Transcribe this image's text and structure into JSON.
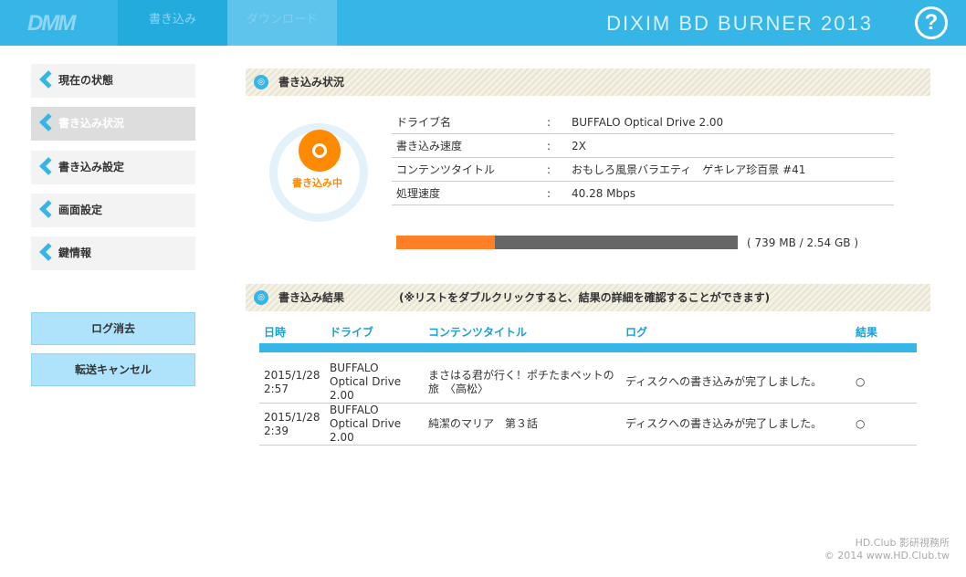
{
  "header": {
    "logo": "DMM",
    "tabs": [
      "書き込み",
      "ダウンロード"
    ],
    "title": "DIXIM BD BURNER 2013",
    "help": "?"
  },
  "sidebar": {
    "items": [
      "現在の状態",
      "書き込み状況",
      "書き込み設定",
      "画面設定",
      "鍵情報"
    ],
    "buttons": [
      "ログ消去",
      "転送キャンセル"
    ]
  },
  "status": {
    "heading": "書き込み状況",
    "state_label": "書き込み中",
    "rows": [
      {
        "k": "ドライブ名",
        "v": "BUFFALO Optical Drive 2.00"
      },
      {
        "k": "書き込み速度",
        "v": "2X"
      },
      {
        "k": "コンテンツタイトル",
        "v": "おもしろ風景バラエティ　ゲキレア珍百景 #41"
      },
      {
        "k": "処理速度",
        "v": "40.28 Mbps"
      }
    ],
    "sep": ":",
    "progress_percent": 29,
    "progress_label": "( 739 MB / 2.54 GB )"
  },
  "results": {
    "heading": "書き込み結果",
    "note": "(※リストをダブルクリックすると、結果の詳細を確認することができます)",
    "columns": [
      "日時",
      "ドライブ",
      "コンテンツタイトル",
      "ログ",
      "結果"
    ],
    "rows": [
      [
        "2015/1/28 2:57",
        "BUFFALO Optical Drive 2.00",
        "まさはる君が行く！ポチたまペットの旅　〈高松〉",
        "ディスクへの書き込みが完了しました。",
        "○"
      ],
      [
        "2015/1/28 2:39",
        "BUFFALO Optical Drive 2.00",
        "純潔のマリア　第３話",
        "ディスクへの書き込みが完了しました。",
        "○"
      ]
    ]
  },
  "watermark": {
    "line1": "HD.Club 影研視務所",
    "line2": "© 2014 www.HD.Club.tw"
  },
  "colors": {
    "accent": "#36b6e6",
    "orange": "#ff7f27"
  }
}
